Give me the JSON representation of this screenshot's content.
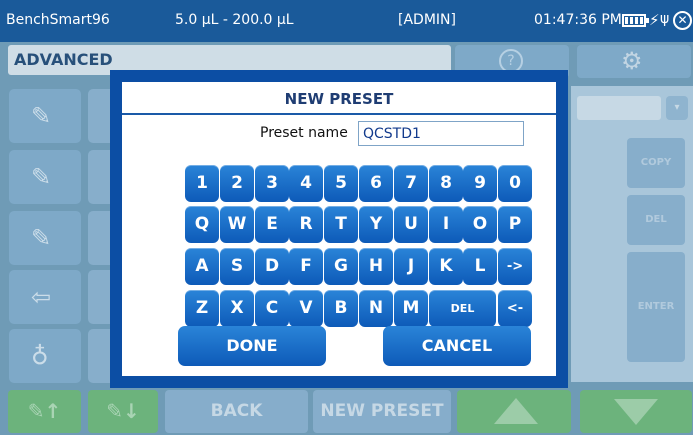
{
  "status": {
    "device": "BenchSmart96",
    "volume_range": "5.0 µL - 200.0 µL",
    "user": "[ADMIN]",
    "time": "01:47:36 PM"
  },
  "mode": {
    "label": "ADVANCED"
  },
  "icons": {
    "battery": "battery-icon",
    "charging": "bolt-icon",
    "usb": "usb-icon",
    "close": "close-icon",
    "help": "help-icon",
    "settings": "gear-icon"
  },
  "right_panel": {
    "copy": "COPY",
    "delete": "DEL",
    "enter": "ENTER"
  },
  "bottom_bar": {
    "back": "BACK",
    "new_preset": "NEW PRESET"
  },
  "dialog": {
    "title": "NEW PRESET",
    "preset_label": "Preset name",
    "preset_value": "QCSTD1",
    "keyboard": {
      "row1": [
        "1",
        "2",
        "3",
        "4",
        "5",
        "6",
        "7",
        "8",
        "9",
        "0"
      ],
      "row2": [
        "Q",
        "W",
        "E",
        "R",
        "T",
        "Y",
        "U",
        "I",
        "O",
        "P"
      ],
      "row3": [
        "A",
        "S",
        "D",
        "F",
        "G",
        "H",
        "J",
        "K",
        "L",
        "->"
      ],
      "row4": [
        "Z",
        "X",
        "C",
        "V",
        "B",
        "N",
        "M",
        "DEL",
        "<-"
      ]
    },
    "done": "DONE",
    "cancel": "CANCEL"
  }
}
